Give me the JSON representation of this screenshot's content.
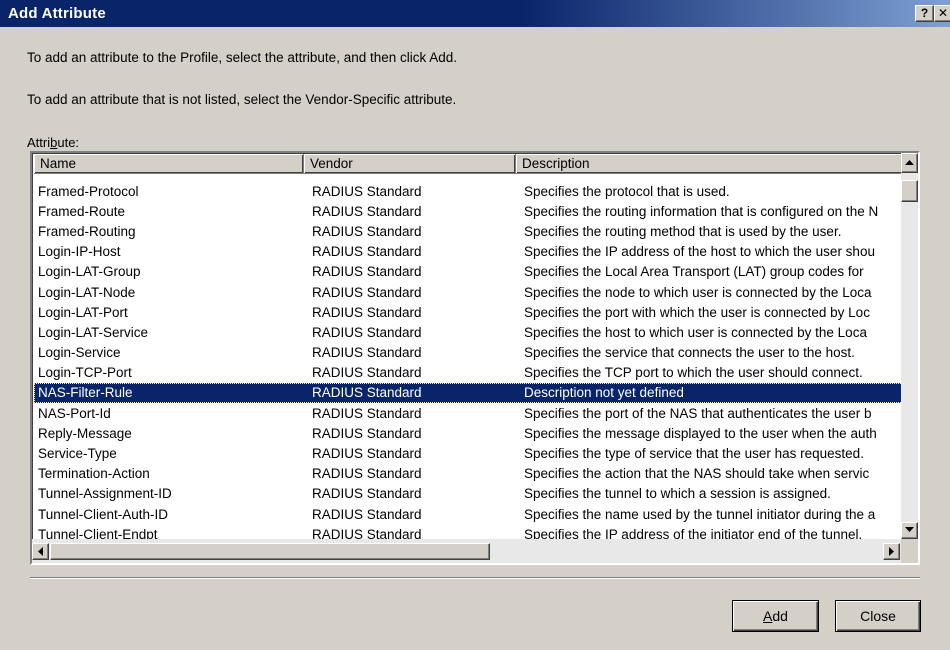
{
  "window": {
    "title": "Add Attribute",
    "help_glyph": "?",
    "close_glyph": "✕"
  },
  "instructions": {
    "line1": "To add an attribute to the Profile, select the attribute, and then click Add.",
    "line2": "To add an attribute that is not listed, select the Vendor-Specific attribute."
  },
  "list": {
    "label": "Attribute:",
    "columns": [
      "Name",
      "Vendor",
      "Description"
    ],
    "selected_index": 10,
    "rows": [
      {
        "name": "Framed-Protocol",
        "vendor": "RADIUS Standard",
        "description": "Specifies the protocol that is used."
      },
      {
        "name": "Framed-Route",
        "vendor": "RADIUS Standard",
        "description": "Specifies the routing information that is configured on the N"
      },
      {
        "name": "Framed-Routing",
        "vendor": "RADIUS Standard",
        "description": "Specifies the routing method that is used by the user."
      },
      {
        "name": "Login-IP-Host",
        "vendor": "RADIUS Standard",
        "description": "Specifies the IP address of the host to which the user shou"
      },
      {
        "name": "Login-LAT-Group",
        "vendor": "RADIUS Standard",
        "description": "Specifies the Local Area Transport (LAT) group codes for"
      },
      {
        "name": "Login-LAT-Node",
        "vendor": "RADIUS Standard",
        "description": "Specifies the node to which user is connected by the Loca"
      },
      {
        "name": "Login-LAT-Port",
        "vendor": "RADIUS Standard",
        "description": "Specifies the port with which the user is connected by Loc"
      },
      {
        "name": "Login-LAT-Service",
        "vendor": "RADIUS Standard",
        "description": "Specifies the host to which user is connected by the Loca"
      },
      {
        "name": "Login-Service",
        "vendor": "RADIUS Standard",
        "description": "Specifies the service that connects the user to the host."
      },
      {
        "name": "Login-TCP-Port",
        "vendor": "RADIUS Standard",
        "description": "Specifies the TCP port to which the user should connect."
      },
      {
        "name": "NAS-Filter-Rule",
        "vendor": "RADIUS Standard",
        "description": "Description not yet defined"
      },
      {
        "name": "NAS-Port-Id",
        "vendor": "RADIUS Standard",
        "description": "Specifies the port of the NAS that authenticates the user b"
      },
      {
        "name": "Reply-Message",
        "vendor": "RADIUS Standard",
        "description": "Specifies the message displayed to the user when the auth"
      },
      {
        "name": "Service-Type",
        "vendor": "RADIUS Standard",
        "description": "Specifies the type of service that the user has requested."
      },
      {
        "name": "Termination-Action",
        "vendor": "RADIUS Standard",
        "description": "Specifies the action that the NAS should take when servic"
      },
      {
        "name": "Tunnel-Assignment-ID",
        "vendor": "RADIUS Standard",
        "description": "Specifies the tunnel to which a session is assigned."
      },
      {
        "name": "Tunnel-Client-Auth-ID",
        "vendor": "RADIUS Standard",
        "description": "Specifies the name used by the tunnel initiator during the a"
      },
      {
        "name": "Tunnel-Client-Endpt",
        "vendor": "RADIUS Standard",
        "description": "Specifies the IP address of the initiator end of the tunnel."
      }
    ]
  },
  "buttons": {
    "add": "Add",
    "close": "Close"
  },
  "icons": {
    "scroll_up": "up-arrow-icon",
    "scroll_down": "down-arrow-icon",
    "scroll_left": "left-arrow-icon",
    "scroll_right": "right-arrow-icon"
  },
  "colors": {
    "title_bar": "#0a246a",
    "selection": "#0a246a",
    "face": "#d4d0c8"
  }
}
